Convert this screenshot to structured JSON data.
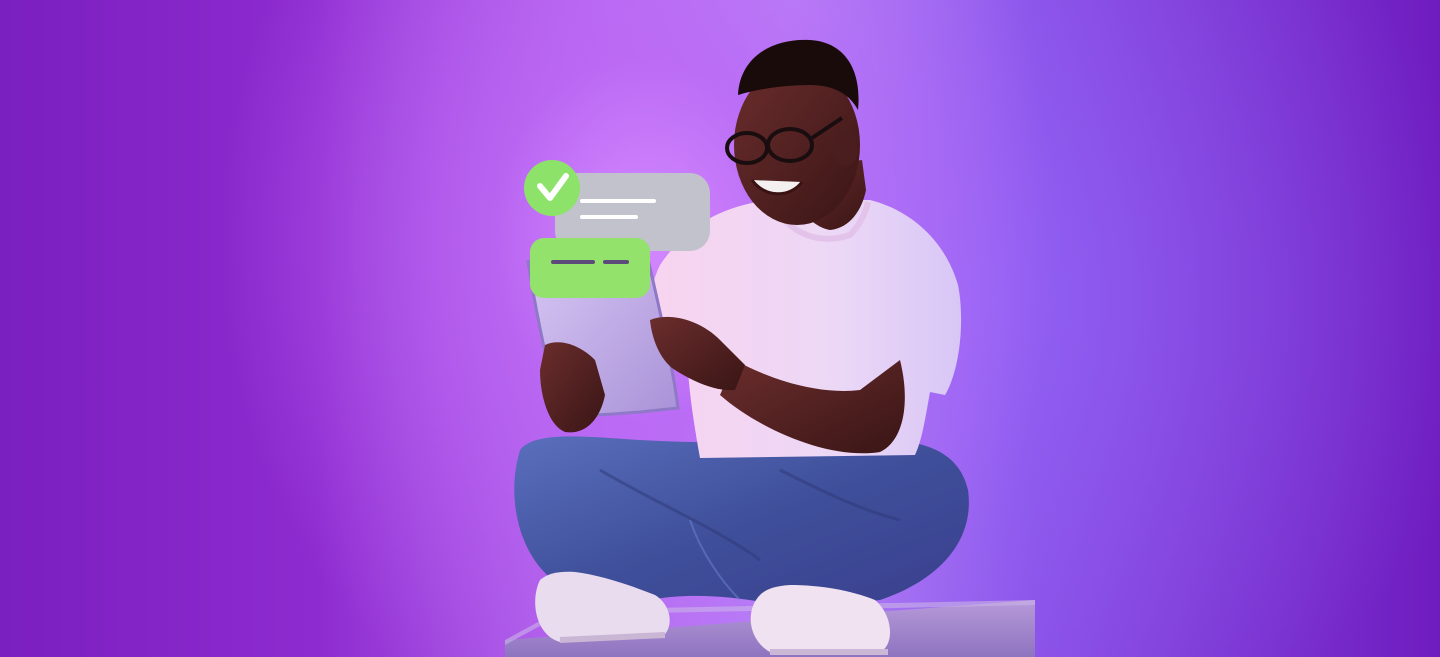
{
  "colors": {
    "background_left": "#7a1fc0",
    "background_center": "#c38af7",
    "background_right": "#6f1cbf",
    "check_badge": "#8de36a",
    "bubble_gray": "#c2c2cc",
    "bubble_green": "#93e26b",
    "bubble_lines_white": "#ffffff",
    "bubble_lines_dark": "#5c4a7a",
    "shirt": "#f3d6f4",
    "jeans": "#4a5aa6",
    "tablet": "#bfa9e8"
  },
  "icons": {
    "check": "check-icon"
  }
}
